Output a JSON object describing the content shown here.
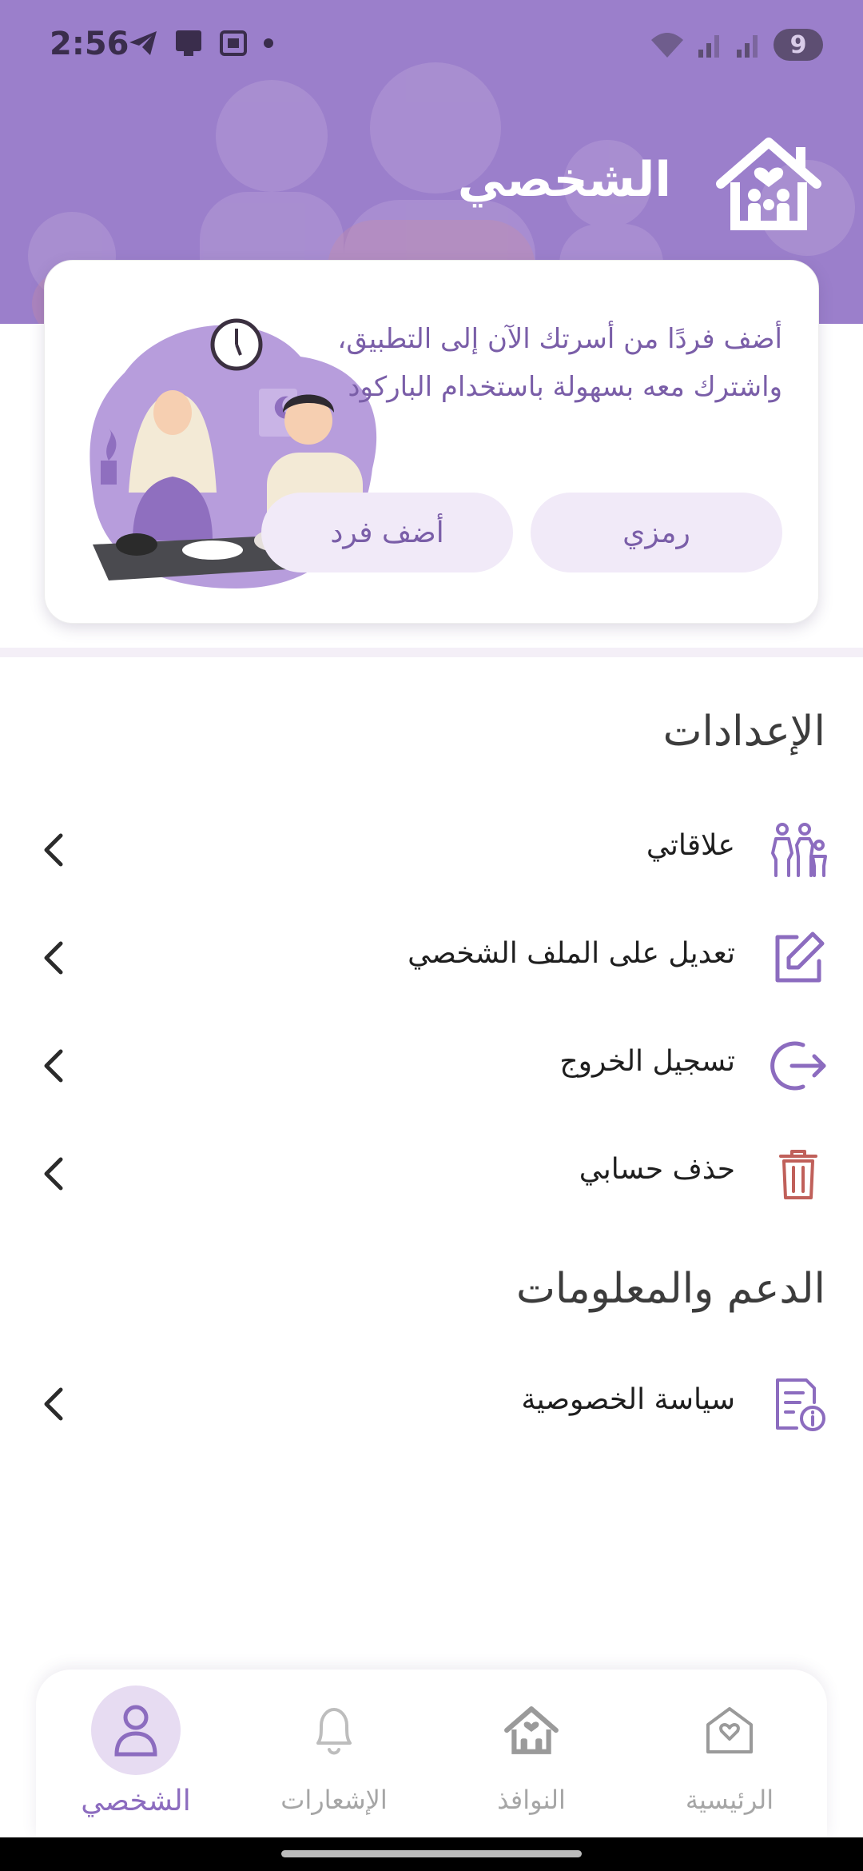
{
  "status_bar": {
    "time": "2:56",
    "battery": "9"
  },
  "header": {
    "title": "الشخصي",
    "logo_icon": "family-house-icon"
  },
  "promo_card": {
    "text": "أضف فردًا من أسرتك الآن إلى التطبيق، واشترك معه بسهولة باستخدام الباركود",
    "code_button": "رمزي",
    "add_button": "أضف فرد",
    "illustration": "couple-dinner-illustration"
  },
  "settings": {
    "title": "الإعدادات",
    "items": [
      {
        "label": "علاقاتي",
        "icon": "family-icon"
      },
      {
        "label": "تعديل على الملف الشخصي",
        "icon": "edit-icon"
      },
      {
        "label": "تسجيل الخروج",
        "icon": "logout-icon"
      },
      {
        "label": "حذف حسابي",
        "icon": "trash-icon"
      }
    ]
  },
  "support": {
    "title": "الدعم والمعلومات",
    "items": [
      {
        "label": "سياسة الخصوصية",
        "icon": "privacy-document-icon"
      }
    ]
  },
  "bottom_nav": {
    "items": [
      {
        "label": "الشخصي",
        "icon": "person-icon",
        "active": true
      },
      {
        "label": "الإشعارات",
        "icon": "bell-icon",
        "active": false
      },
      {
        "label": "النوافذ",
        "icon": "family-house-icon",
        "active": false
      },
      {
        "label": "الرئيسية",
        "icon": "home-heart-icon",
        "active": false
      }
    ]
  },
  "colors": {
    "primary": "#9b7fcb",
    "accent_text": "#7a5ea8",
    "danger": "#c0605a"
  }
}
